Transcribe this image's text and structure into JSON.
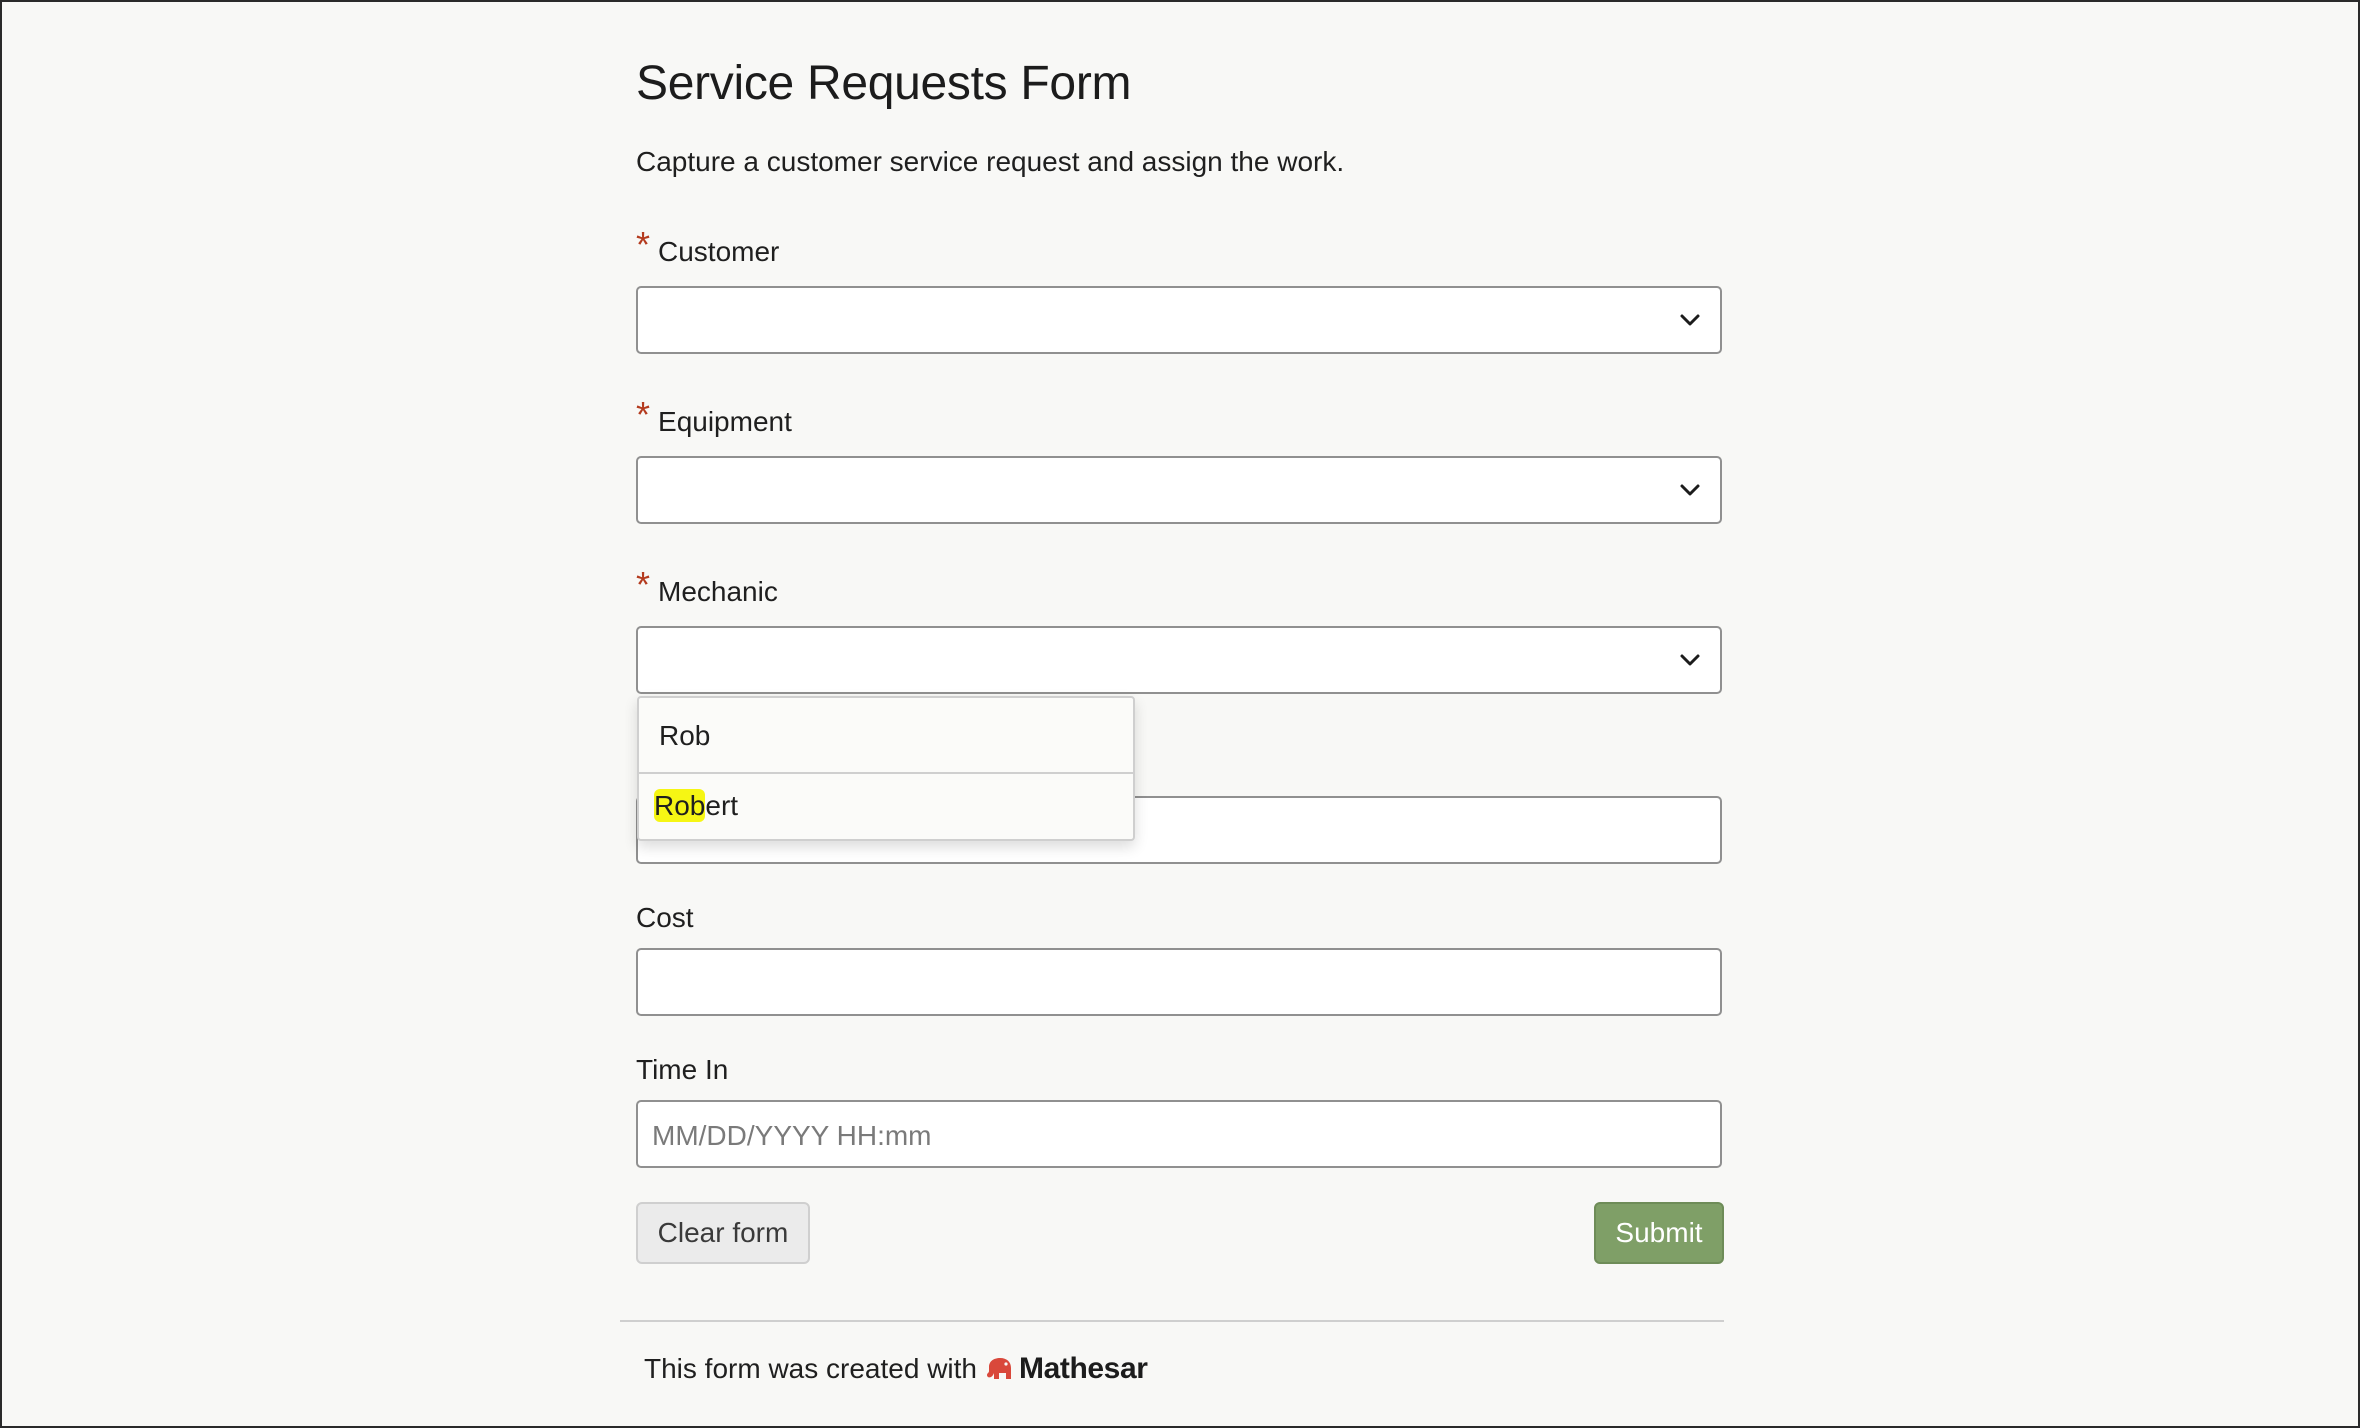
{
  "form": {
    "title": "Service Requests Form",
    "description": "Capture a customer service request and assign the work.",
    "required_marker": "*",
    "fields": {
      "customer": {
        "label": "Customer",
        "value": ""
      },
      "equipment": {
        "label": "Equipment",
        "value": ""
      },
      "mechanic": {
        "label": "Mechanic",
        "value": ""
      },
      "cost": {
        "label": "Cost",
        "value": ""
      },
      "time_in": {
        "label": "Time In",
        "placeholder": "MM/DD/YYYY HH:mm"
      }
    },
    "dropdown": {
      "search_text": "Rob",
      "option": {
        "match": "Rob",
        "rest": "ert"
      }
    },
    "buttons": {
      "clear": "Clear form",
      "submit": "Submit"
    }
  },
  "footer": {
    "text": "This form was created with",
    "brand": "Mathesar"
  },
  "colors": {
    "required": "#b43b1f",
    "submit_bg": "#7f9f67",
    "highlight": "#f6f614",
    "brand_icon": "#d9483b"
  },
  "icons": {
    "select_chevron": "chevron-down-icon",
    "brand_logo": "elephant-icon"
  }
}
